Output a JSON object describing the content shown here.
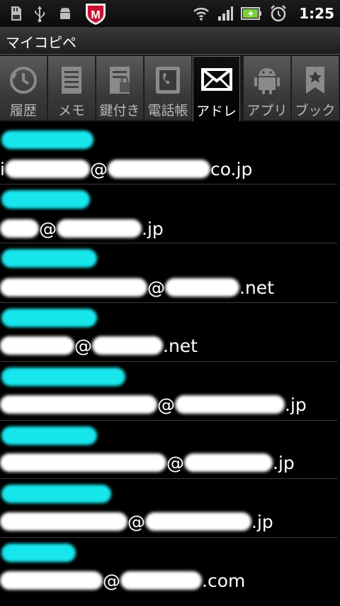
{
  "status_bar": {
    "time": "1:25",
    "left_icons": [
      "sd-card-icon",
      "usb-icon",
      "android-debug-icon",
      "security-shield-icon"
    ],
    "shield_letter": "M",
    "right_icons": [
      "wifi-icon",
      "signal-icon",
      "battery-icon",
      "alarm-icon"
    ]
  },
  "app": {
    "title": "マイコピペ"
  },
  "tabs": [
    {
      "label": "履歴",
      "icon": "history-icon",
      "active": false
    },
    {
      "label": "メモ",
      "icon": "memo-icon",
      "active": false
    },
    {
      "label": "鍵付き",
      "icon": "locked-note-icon",
      "active": false
    },
    {
      "label": "電話帳",
      "icon": "phonebook-icon",
      "active": false
    },
    {
      "label": "アドレ",
      "icon": "mail-icon",
      "active": true
    },
    {
      "label": "アプリ",
      "icon": "android-icon",
      "active": false
    },
    {
      "label": "ブック",
      "icon": "bookmark-icon",
      "active": false
    }
  ],
  "entries": [
    {
      "email_parts": [
        "i",
        "@",
        "co.jp"
      ]
    },
    {
      "email_parts": [
        "@",
        ".jp"
      ]
    },
    {
      "email_parts": [
        "@",
        ".net"
      ]
    },
    {
      "email_parts": [
        "@",
        ".net"
      ]
    },
    {
      "email_parts": [
        "@",
        ".jp"
      ]
    },
    {
      "email_parts": [
        "@",
        ".jp"
      ]
    },
    {
      "email_parts": [
        "@",
        ".jp"
      ]
    },
    {
      "email_parts": [
        "@",
        ".com"
      ]
    }
  ],
  "colors": {
    "name_mask": "#17e6ec",
    "email_mask": "#ffffff",
    "active_tab_bg": "#000000"
  }
}
